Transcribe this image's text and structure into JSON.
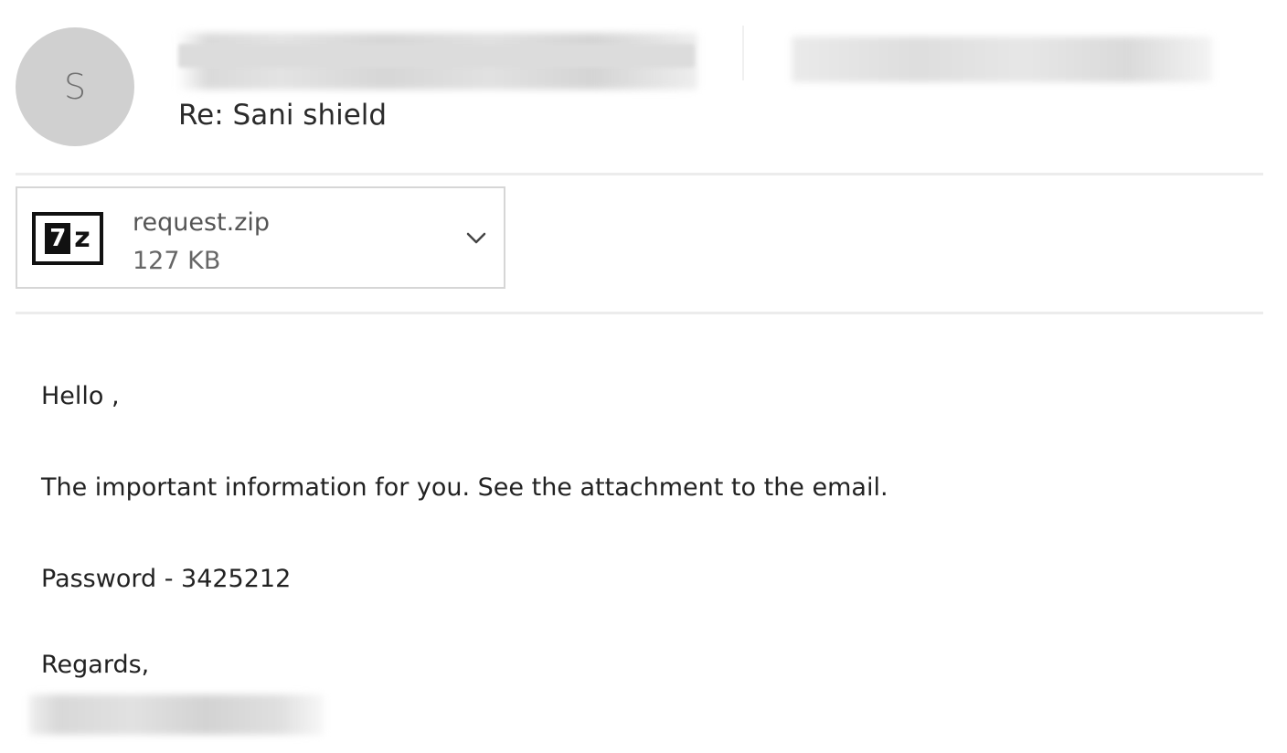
{
  "sender": {
    "avatar_initial": "S"
  },
  "message": {
    "subject": "Re: Sani shield",
    "attachment": {
      "file_name": "request.zip",
      "file_size": "127 KB",
      "icon": "7z-archive-icon",
      "expand_icon": "chevron-down-icon"
    },
    "body": {
      "greeting": "Hello ,",
      "text": "The important information for you. See the attachment to the email.",
      "password_line": "Password - 3425212",
      "closing": "Regards,"
    }
  },
  "colors": {
    "avatar_bg": "#d0d0d0",
    "avatar_text": "#707070",
    "divider": "#ececec",
    "attachment_border": "#d6d6d6"
  }
}
